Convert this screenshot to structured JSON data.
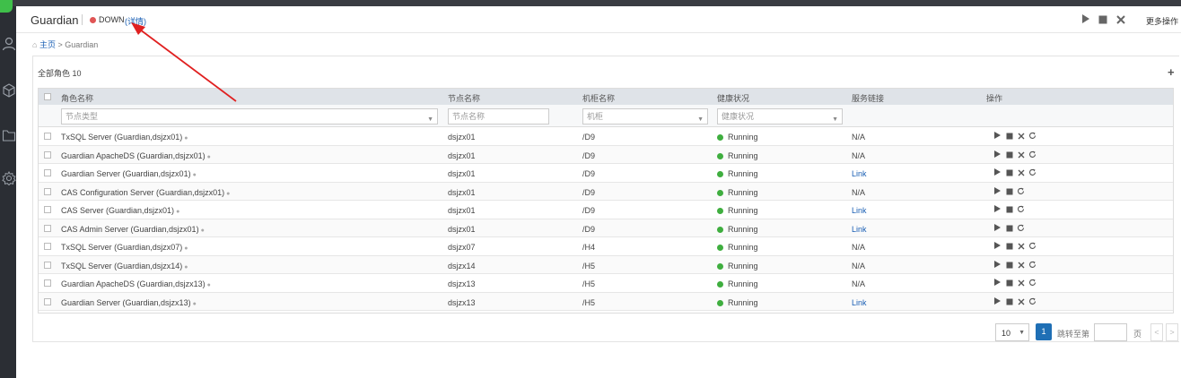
{
  "app": {
    "title": "Guardian",
    "status": "DOWN",
    "status_color": "#e05555",
    "detail_link": "(详情)",
    "more_ops": "更多操作"
  },
  "header_icons": [
    "play-icon",
    "stop-icon",
    "close-icon"
  ],
  "breadcrumb": {
    "home": "主页",
    "sep": ">",
    "current": "Guardian"
  },
  "panel": {
    "title": "全部角色 10"
  },
  "columns": {
    "role": "角色名称",
    "node": "节点名称",
    "rack": "机柜名称",
    "health": "健康状况",
    "service": "服务链接",
    "ops": "操作"
  },
  "filters": {
    "role_placeholder": "节点类型",
    "node_placeholder": "节点名称",
    "rack_placeholder": "机柜",
    "health_placeholder": "健康状况"
  },
  "rows": [
    {
      "role": "TxSQL Server (Guardian,dsjzx01)",
      "node": "dsjzx01",
      "rack": "/D9",
      "health": "Running",
      "service": "N/A",
      "service_is_link": false,
      "ops": [
        "play",
        "stop",
        "delete",
        "restart"
      ]
    },
    {
      "role": "Guardian ApacheDS (Guardian,dsjzx01)",
      "node": "dsjzx01",
      "rack": "/D9",
      "health": "Running",
      "service": "N/A",
      "service_is_link": false,
      "ops": [
        "play",
        "stop",
        "delete",
        "restart"
      ]
    },
    {
      "role": "Guardian Server (Guardian,dsjzx01)",
      "node": "dsjzx01",
      "rack": "/D9",
      "health": "Running",
      "service": "Link",
      "service_is_link": true,
      "ops": [
        "play",
        "stop",
        "delete",
        "restart"
      ]
    },
    {
      "role": "CAS Configuration Server (Guardian,dsjzx01)",
      "node": "dsjzx01",
      "rack": "/D9",
      "health": "Running",
      "service": "N/A",
      "service_is_link": false,
      "ops": [
        "play",
        "stop",
        "restart"
      ]
    },
    {
      "role": "CAS Server (Guardian,dsjzx01)",
      "node": "dsjzx01",
      "rack": "/D9",
      "health": "Running",
      "service": "Link",
      "service_is_link": true,
      "ops": [
        "play",
        "stop",
        "restart"
      ]
    },
    {
      "role": "CAS Admin Server (Guardian,dsjzx01)",
      "node": "dsjzx01",
      "rack": "/D9",
      "health": "Running",
      "service": "Link",
      "service_is_link": true,
      "ops": [
        "play",
        "stop",
        "restart"
      ]
    },
    {
      "role": "TxSQL Server (Guardian,dsjzx07)",
      "node": "dsjzx07",
      "rack": "/H4",
      "health": "Running",
      "service": "N/A",
      "service_is_link": false,
      "ops": [
        "play",
        "stop",
        "delete",
        "restart"
      ]
    },
    {
      "role": "TxSQL Server (Guardian,dsjzx14)",
      "node": "dsjzx14",
      "rack": "/H5",
      "health": "Running",
      "service": "N/A",
      "service_is_link": false,
      "ops": [
        "play",
        "stop",
        "delete",
        "restart"
      ]
    },
    {
      "role": "Guardian ApacheDS (Guardian,dsjzx13)",
      "node": "dsjzx13",
      "rack": "/H5",
      "health": "Running",
      "service": "N/A",
      "service_is_link": false,
      "ops": [
        "play",
        "stop",
        "delete",
        "restart"
      ]
    },
    {
      "role": "Guardian Server (Guardian,dsjzx13)",
      "node": "dsjzx13",
      "rack": "/H5",
      "health": "Running",
      "service": "Link",
      "service_is_link": true,
      "ops": [
        "play",
        "stop",
        "delete",
        "restart"
      ]
    }
  ],
  "health_color": "#3fae3f",
  "pagination": {
    "page_size": "10",
    "current_page": "1",
    "jump_label": "跳转至第",
    "page_suffix": "页",
    "prev": "<",
    "next": ">"
  },
  "annotation": {
    "color": "#e02020"
  }
}
